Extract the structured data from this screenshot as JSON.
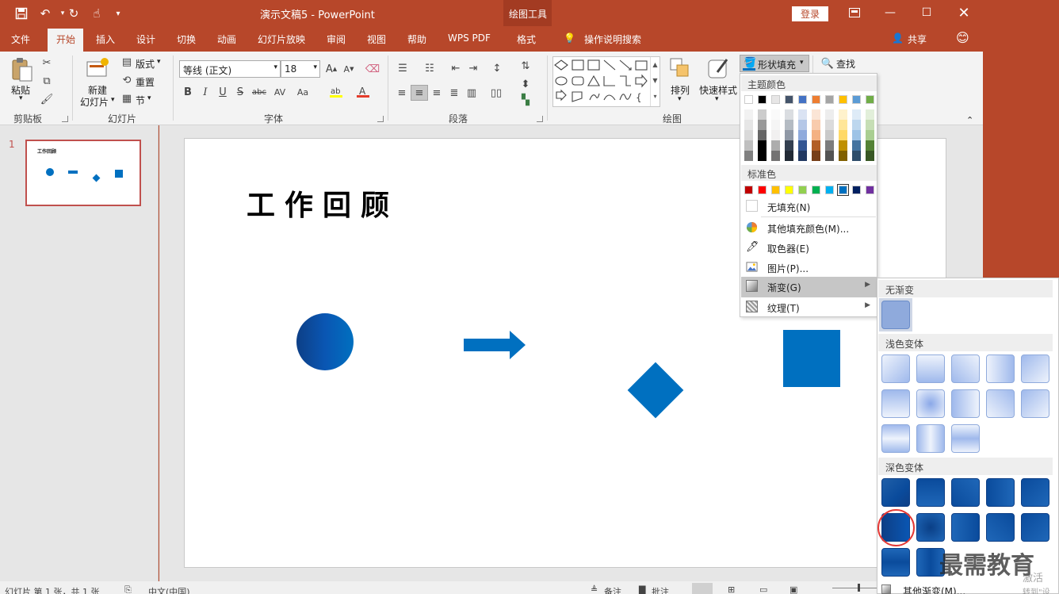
{
  "titlebar": {
    "doc_title": "演示文稿5  -  PowerPoint",
    "tools_label": "绘图工具",
    "login": "登录",
    "qa_icons": [
      "save-icon",
      "undo-icon",
      "redo-icon",
      "touch-mode-icon",
      "customize-icon"
    ],
    "win_icons": [
      "ribbon-display-icon",
      "minimize-icon",
      "maximize-icon",
      "close-icon"
    ]
  },
  "tabs": [
    "文件",
    "开始",
    "插入",
    "设计",
    "切换",
    "动画",
    "幻灯片放映",
    "审阅",
    "视图",
    "帮助",
    "WPS PDF",
    "格式"
  ],
  "tell_me": "操作说明搜索",
  "share": "共享",
  "ribbon": {
    "clipboard": {
      "paste": "粘贴",
      "label": "剪贴板"
    },
    "slides": {
      "new_slide_1": "新建",
      "new_slide_2": "幻灯片",
      "layout": "版式",
      "reset": "重置",
      "section": "节",
      "label": "幻灯片"
    },
    "font": {
      "name": "等线 (正文)",
      "size": "18",
      "label": "字体",
      "buttons": [
        "B",
        "I",
        "U",
        "S",
        "abc",
        "AV",
        "Aa"
      ]
    },
    "paragraph": {
      "label": "段落"
    },
    "drawing": {
      "arrange": "排列",
      "quick_styles": "快速样式",
      "shape_fill": "形状填充",
      "label": "绘图"
    },
    "editing": {
      "find": "查找"
    }
  },
  "slide_panel": {
    "number": "1",
    "thumb_title": "工作回顾"
  },
  "slide": {
    "title": "工作回顾"
  },
  "status": {
    "left": "幻灯片 第 1 张，共 1 张",
    "lang": "中文(中国)",
    "notes": "备注",
    "comments": "批注"
  },
  "fill_menu": {
    "theme_colors_header": "主题颜色",
    "theme_top": [
      "#ffffff",
      "#000000",
      "#e7e6e6",
      "#44546a",
      "#4472c4",
      "#ed7d31",
      "#a5a5a5",
      "#ffc000",
      "#5b9bd5",
      "#70ad47"
    ],
    "standard_header": "标准色",
    "standard": [
      "#c00000",
      "#ff0000",
      "#ffc000",
      "#ffff00",
      "#92d050",
      "#00b050",
      "#00b0f0",
      "#0070c0",
      "#002060",
      "#7030a0"
    ],
    "no_fill": "无填充(N)",
    "more_colors": "其他填充颜色(M)...",
    "eyedropper": "取色器(E)",
    "picture": "图片(P)...",
    "gradient": "渐变(G)",
    "texture": "纹理(T)"
  },
  "gradient_menu": {
    "no_gradient": "无渐变",
    "light": "浅色变体",
    "dark": "深色变体",
    "more": "其他渐变(M)..."
  },
  "watermark": {
    "main": "最需教育",
    "sub1": "激活",
    "sub2": "转到\"设"
  },
  "colors": {
    "accent": "#b7472a",
    "shape_blue": "#0070c0"
  }
}
